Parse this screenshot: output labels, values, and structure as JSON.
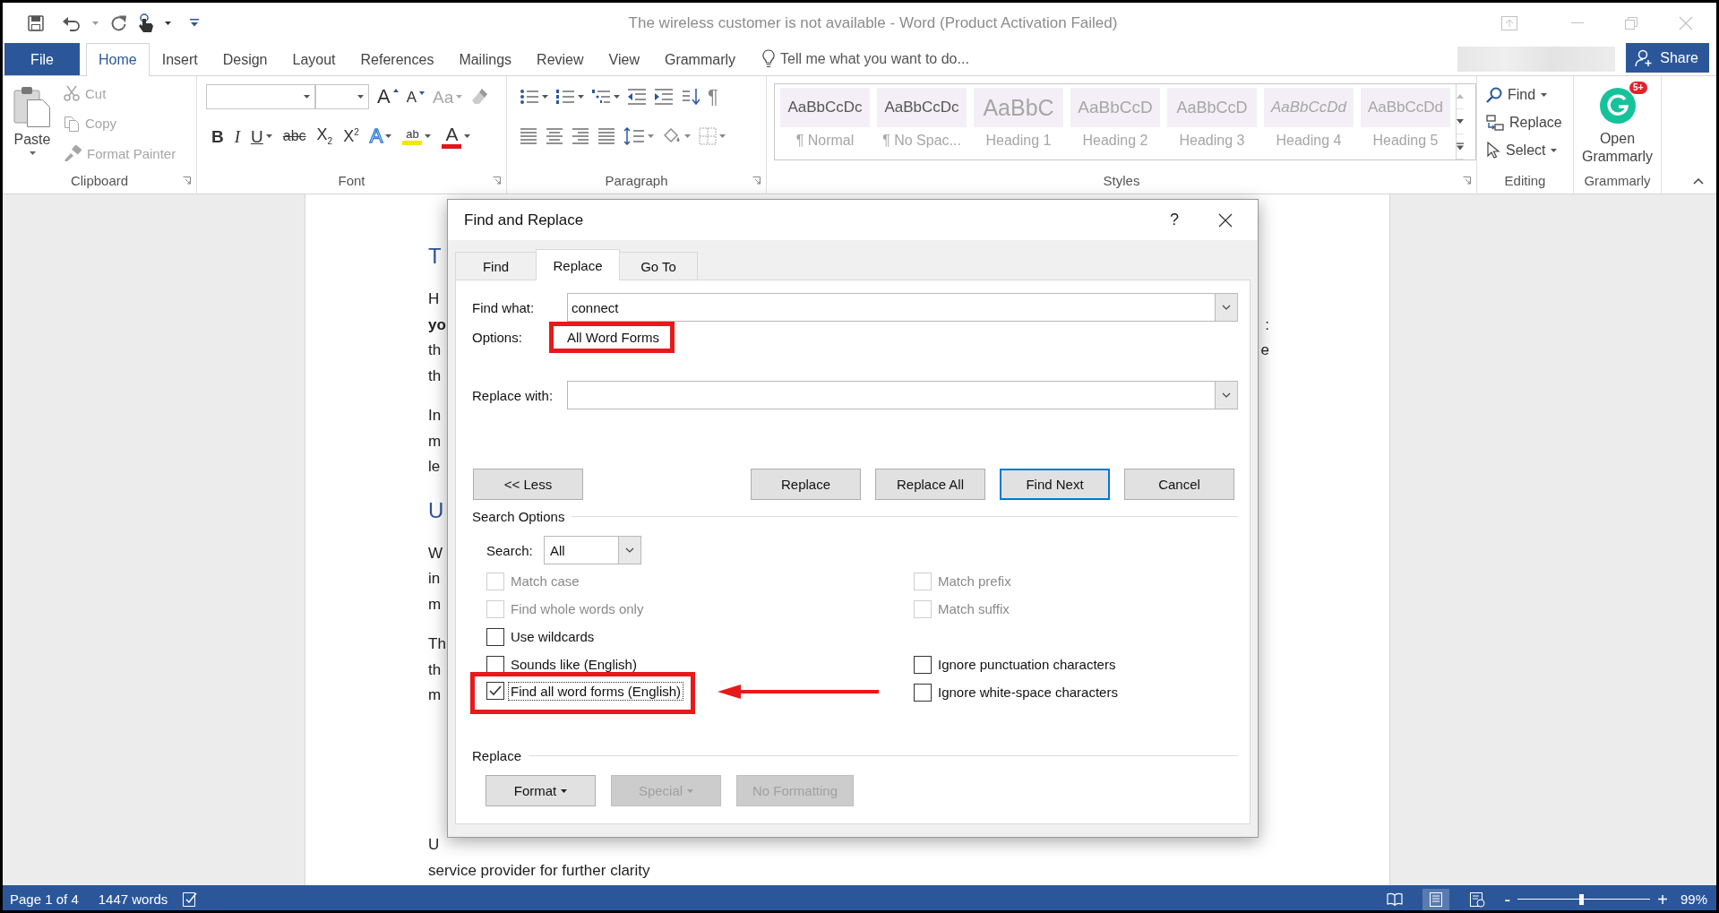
{
  "window": {
    "title": "The wireless customer is not available - Word (Product Activation Failed)"
  },
  "ribbon_tabs": [
    {
      "label": "File",
      "kind": "file",
      "selected": false
    },
    {
      "label": "Home",
      "kind": "tab",
      "selected": true
    },
    {
      "label": "Insert",
      "kind": "tab",
      "selected": false
    },
    {
      "label": "Design",
      "kind": "tab",
      "selected": false
    },
    {
      "label": "Layout",
      "kind": "tab",
      "selected": false
    },
    {
      "label": "References",
      "kind": "tab",
      "selected": false
    },
    {
      "label": "Mailings",
      "kind": "tab",
      "selected": false
    },
    {
      "label": "Review",
      "kind": "tab",
      "selected": false
    },
    {
      "label": "View",
      "kind": "tab",
      "selected": false
    },
    {
      "label": "Grammarly",
      "kind": "tab",
      "selected": false
    }
  ],
  "tell_me": {
    "placeholder": "Tell me what you want to do..."
  },
  "share": {
    "label": "Share"
  },
  "ribbon": {
    "clipboard": {
      "label": "Clipboard",
      "paste": "Paste",
      "items": [
        {
          "kind": "cut",
          "label": "Cut",
          "disabled": true
        },
        {
          "kind": "copy",
          "label": "Copy",
          "disabled": true
        },
        {
          "kind": "format_painter",
          "label": "Format Painter",
          "disabled": true
        }
      ]
    },
    "font": {
      "label": "Font",
      "tools_top": [
        {
          "kind": "grow",
          "label": "A",
          "disabled": false
        },
        {
          "kind": "shrink",
          "label": "A",
          "disabled": false
        },
        {
          "kind": "case",
          "label": "Aa",
          "disabled": true
        }
      ],
      "tools_bottom": [
        {
          "kind": "bold",
          "label": "B",
          "disabled": false
        },
        {
          "kind": "italic",
          "label": "I",
          "disabled": false
        },
        {
          "kind": "underline",
          "label": "U",
          "disabled": false
        },
        {
          "kind": "strike",
          "label": "abc",
          "disabled": false
        },
        {
          "kind": "sub",
          "label": "X$_{2}$",
          "disabled": false
        },
        {
          "kind": "super",
          "label": "X$^{2}$",
          "disabled": false
        },
        {
          "kind": "effects",
          "label": "A",
          "disabled": false
        },
        {
          "kind": "highlight",
          "label": "ab",
          "disabled": false
        },
        {
          "kind": "color",
          "label": "A",
          "disabled": false
        }
      ]
    },
    "paragraph": {
      "label": "Paragraph",
      "show_marks": "¶"
    },
    "styles": {
      "label": "Styles",
      "items": [
        {
          "kind": "normal",
          "sample": "AaBbCcDc",
          "name": "¶ Normal"
        },
        {
          "kind": "no_spacing",
          "sample": "AaBbCcDc",
          "name": "¶ No Spac..."
        },
        {
          "kind": "heading1",
          "sample": "AaBbC",
          "name": "Heading 1"
        },
        {
          "kind": "heading2",
          "sample": "AaBbCcD",
          "name": "Heading 2"
        },
        {
          "kind": "heading3",
          "sample": "AaBbCcD",
          "name": "Heading 3"
        },
        {
          "kind": "heading4",
          "sample": "AaBbCcDd",
          "name": "Heading 4"
        },
        {
          "kind": "heading5",
          "sample": "AaBbCcDd",
          "name": "Heading 5"
        }
      ]
    },
    "editing": {
      "label": "Editing",
      "items": [
        {
          "kind": "find",
          "label": "Find"
        },
        {
          "kind": "replace",
          "label": "Replace"
        },
        {
          "kind": "select",
          "label": "Select"
        }
      ]
    },
    "grammarly": {
      "label": "Grammarly",
      "button": "Open Grammarly",
      "badge": "5+"
    }
  },
  "document": {
    "paragraphs": [
      {
        "kind": "heading",
        "lines": [
          {
            "text": "T",
            "bold": false
          }
        ]
      },
      {
        "kind": "body",
        "lines": [
          {
            "text": "H",
            "bold": false
          },
          {
            "text": "yo",
            "bold": true,
            "tail": ":"
          },
          {
            "text": "th",
            "bold": false,
            "tail": "e"
          },
          {
            "text": "th",
            "bold": false
          }
        ]
      },
      {
        "kind": "body",
        "lines": [
          {
            "text": "In",
            "bold": false
          },
          {
            "text": "m",
            "bold": false
          },
          {
            "text": "le",
            "bold": false
          }
        ]
      },
      {
        "kind": "heading",
        "lines": [
          {
            "text": "U",
            "bold": false
          }
        ]
      },
      {
        "kind": "body",
        "lines": [
          {
            "text": "W",
            "bold": false
          },
          {
            "text": "in",
            "bold": false
          },
          {
            "text": "m",
            "bold": false
          }
        ]
      },
      {
        "kind": "body",
        "lines": [
          {
            "text": "Th",
            "bold": false
          },
          {
            "text": "th",
            "bold": false
          },
          {
            "text": "m",
            "bold": false
          }
        ]
      },
      {
        "kind": "body",
        "lines": [
          {
            "text": "U",
            "bold": false
          },
          {
            "text": "service provider for further clarity",
            "bold": false
          }
        ]
      }
    ]
  },
  "dialog": {
    "title": "Find and Replace",
    "help": "?",
    "tabs": [
      {
        "label": "Find",
        "selected": false
      },
      {
        "label": "Replace",
        "selected": true
      },
      {
        "label": "Go To",
        "selected": false
      }
    ],
    "find_what": {
      "label": "Find what:",
      "value": "connect"
    },
    "options": {
      "label": "Options:",
      "value": "All Word Forms",
      "highlighted": true
    },
    "replace_with": {
      "label": "Replace with:"
    },
    "buttons": [
      {
        "label": "<< Less",
        "default": false
      },
      {
        "label": "Replace",
        "default": false
      },
      {
        "label": "Replace All",
        "default": false
      },
      {
        "label": "Find Next",
        "default": true
      },
      {
        "label": "Cancel",
        "default": false
      }
    ],
    "search_options": {
      "title": "Search Options",
      "search_label": "Search:",
      "search_value": "All",
      "rows": [
        {
          "left": {
            "label": "Match case",
            "checked": false,
            "disabled": true,
            "focused": false,
            "highlighted": false
          },
          "right": {
            "label": "Match prefix",
            "checked": false,
            "disabled": true,
            "focused": false,
            "highlighted": false
          }
        },
        {
          "left": {
            "label": "Find whole words only",
            "checked": false,
            "disabled": true,
            "focused": false,
            "highlighted": false
          },
          "right": {
            "label": "Match suffix",
            "checked": false,
            "disabled": true,
            "focused": false,
            "highlighted": false
          }
        },
        {
          "left": {
            "label": "Use wildcards",
            "checked": false,
            "disabled": false,
            "focused": false,
            "highlighted": false
          }
        },
        {
          "left": {
            "label": "Sounds like (English)",
            "checked": false,
            "disabled": false,
            "focused": false,
            "highlighted": false
          },
          "right": {
            "label": "Ignore punctuation characters",
            "checked": false,
            "disabled": false,
            "focused": false,
            "highlighted": false
          }
        },
        {
          "left": {
            "label": "Find all word forms (English)",
            "checked": true,
            "disabled": false,
            "focused": true,
            "highlighted": true
          },
          "right": {
            "label": "Ignore white-space characters",
            "checked": false,
            "disabled": false,
            "focused": false,
            "highlighted": false
          }
        }
      ]
    },
    "replace_section": {
      "title": "Replace",
      "buttons": [
        {
          "label": "Format",
          "disabled": false,
          "menu": true
        },
        {
          "label": "Special",
          "disabled": true,
          "menu": true
        },
        {
          "label": "No Formatting",
          "disabled": true,
          "menu": false
        }
      ]
    }
  },
  "status_bar": {
    "page": "Page 1 of 4",
    "words": "1447 words",
    "views": [
      {
        "kind": "read",
        "selected": false
      },
      {
        "kind": "print",
        "selected": true
      },
      {
        "kind": "web",
        "selected": false
      }
    ],
    "zoom": {
      "out": "-",
      "in": "+",
      "level": 0.48,
      "reading": "99%"
    }
  }
}
